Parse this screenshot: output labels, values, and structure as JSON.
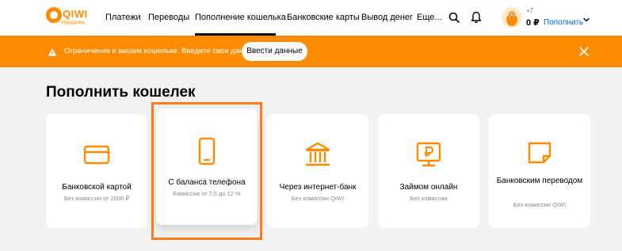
{
  "header": {
    "logo_text": "QIWI",
    "logo_sub": "#будудома",
    "nav": [
      "Платежи",
      "Переводы",
      "Пополнение кошелька",
      "Банковские карты",
      "Вывод денег",
      "Еще..."
    ],
    "balance_prefix": "+7",
    "balance": "0 ₽",
    "topup": "Пополнить"
  },
  "banner": {
    "text": "Ограничения в вашем кошельке. Введите свои данные!",
    "button": "Ввести данные"
  },
  "page": {
    "title": "Пополнить кошелек"
  },
  "cards": [
    {
      "title": "Банковской картой",
      "sub": "Без комиссии от 2000 ₽",
      "icon": "card-icon"
    },
    {
      "title": "С баланса телефона",
      "sub": "Комиссия от 7,5 до 12 %",
      "icon": "phone-icon"
    },
    {
      "title": "Через интернет-банк",
      "sub": "Без комиссии QIWI",
      "icon": "bank-icon"
    },
    {
      "title": "Займом онлайн",
      "sub": "Без комиссии",
      "icon": "monitor-ruble-icon"
    },
    {
      "title": "Банковским переводом",
      "sub": "Без комиссии QIWI",
      "icon": "document-icon"
    }
  ],
  "colors": {
    "accent": "#ff8c00",
    "highlight": "#ff7a1a",
    "link": "#0061ff",
    "background": "#f2f2f2"
  }
}
